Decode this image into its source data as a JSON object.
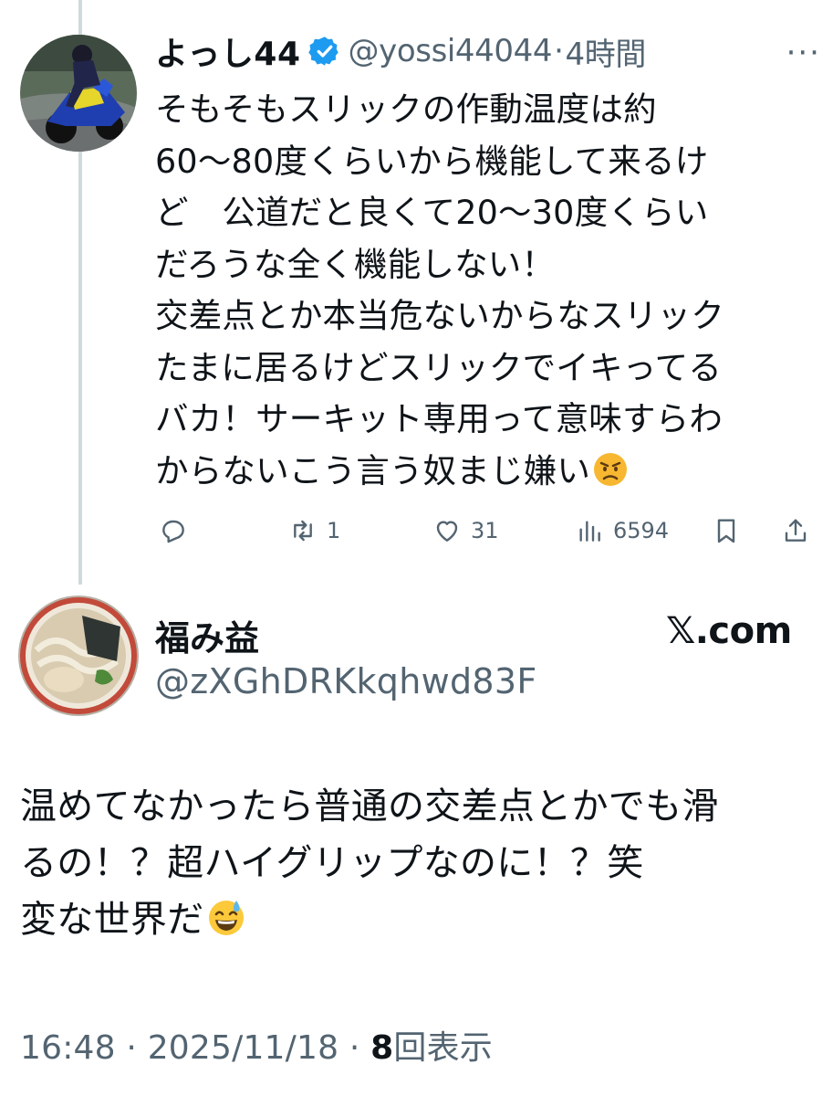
{
  "reply": {
    "author_name": "よっし44",
    "handle": "@yossi44044",
    "separator": "·",
    "time_ago": "4時間",
    "more_label": "···",
    "body_lines": [
      "そもそもスリックの作動温度は約",
      "60〜80度くらいから機能して来るけ",
      "ど　公道だと良くて20〜30度くらい",
      "だろうな全く機能しない！",
      "交差点とか本当危ないからなスリック",
      "たまに居るけどスリックでイキってる",
      "バカ！サーキット専用って意味すらわ",
      "からないこう言う奴まじ嫌い"
    ],
    "emoji": "angry-face",
    "actions": {
      "reply_count": "",
      "retweet_count": "1",
      "like_count": "31",
      "views_count": "6594"
    }
  },
  "quoted": {
    "author_name": "福み益",
    "handle": "@zXGhDRKkqhwd83F",
    "site_label": "𝕏.com",
    "body_lines": [
      "温めてなかったら普通の交差点とかでも滑",
      "るの！？超ハイグリップなのに！？笑",
      "変な世界だ"
    ],
    "emoji": "grinning-face-with-sweat",
    "time": "16:48",
    "date": "2025/11/18",
    "views_number": "8",
    "views_label": "回表示"
  },
  "colors": {
    "text": "#0f1419",
    "muted": "#536471",
    "verified": "#1d9bf0",
    "thread_line": "#cfd9de"
  }
}
